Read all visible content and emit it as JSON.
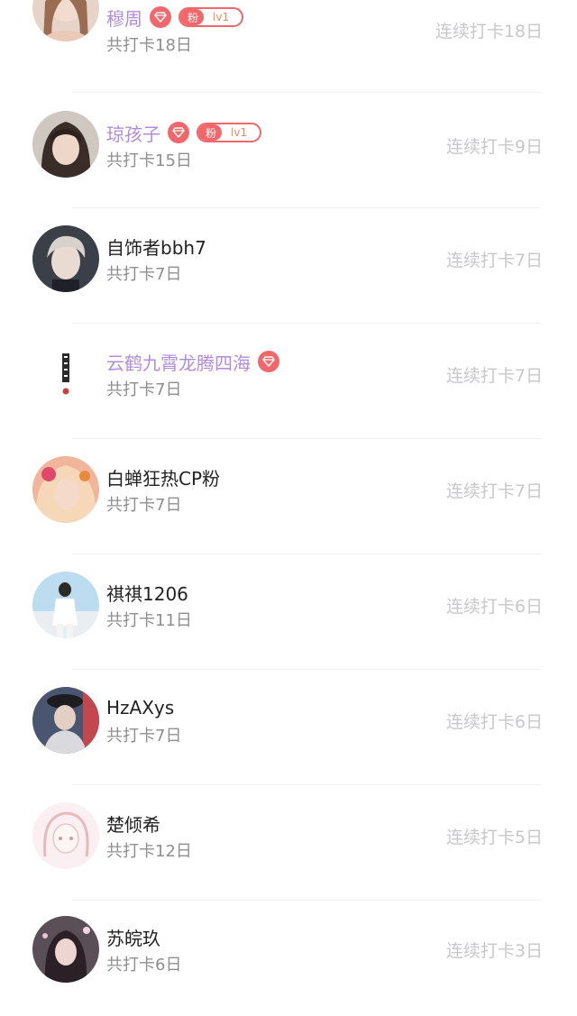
{
  "badges": {
    "fan_label": "粉",
    "level_label": "lv1",
    "diamond_color": "#f2676a"
  },
  "users": [
    {
      "name": "穆周",
      "name_style": "vip",
      "diamond": true,
      "fan_badge": true,
      "total": "共打卡18日",
      "streak": "连续打卡18日"
    },
    {
      "name": "琼孩子",
      "name_style": "vip",
      "diamond": true,
      "fan_badge": true,
      "total": "共打卡15日",
      "streak": "连续打卡9日"
    },
    {
      "name": "自饰者bbh7",
      "name_style": "normal",
      "diamond": false,
      "fan_badge": false,
      "total": "共打卡7日",
      "streak": "连续打卡7日"
    },
    {
      "name": "云鹤九霄龙腾四海",
      "name_style": "vip",
      "diamond": true,
      "fan_badge": false,
      "total": "共打卡7日",
      "streak": "连续打卡7日"
    },
    {
      "name": "白蝉狂热CP粉",
      "name_style": "normal",
      "diamond": false,
      "fan_badge": false,
      "total": "共打卡7日",
      "streak": "连续打卡7日"
    },
    {
      "name": "祺祺1206",
      "name_style": "normal",
      "diamond": false,
      "fan_badge": false,
      "total": "共打卡11日",
      "streak": "连续打卡6日"
    },
    {
      "name": "HzAXys",
      "name_style": "normal",
      "diamond": false,
      "fan_badge": false,
      "total": "共打卡7日",
      "streak": "连续打卡6日"
    },
    {
      "name": "楚倾希",
      "name_style": "normal",
      "diamond": false,
      "fan_badge": false,
      "total": "共打卡12日",
      "streak": "连续打卡5日"
    },
    {
      "name": "苏皖玖",
      "name_style": "normal",
      "diamond": false,
      "fan_badge": false,
      "total": "共打卡6日",
      "streak": "连续打卡3日"
    }
  ]
}
